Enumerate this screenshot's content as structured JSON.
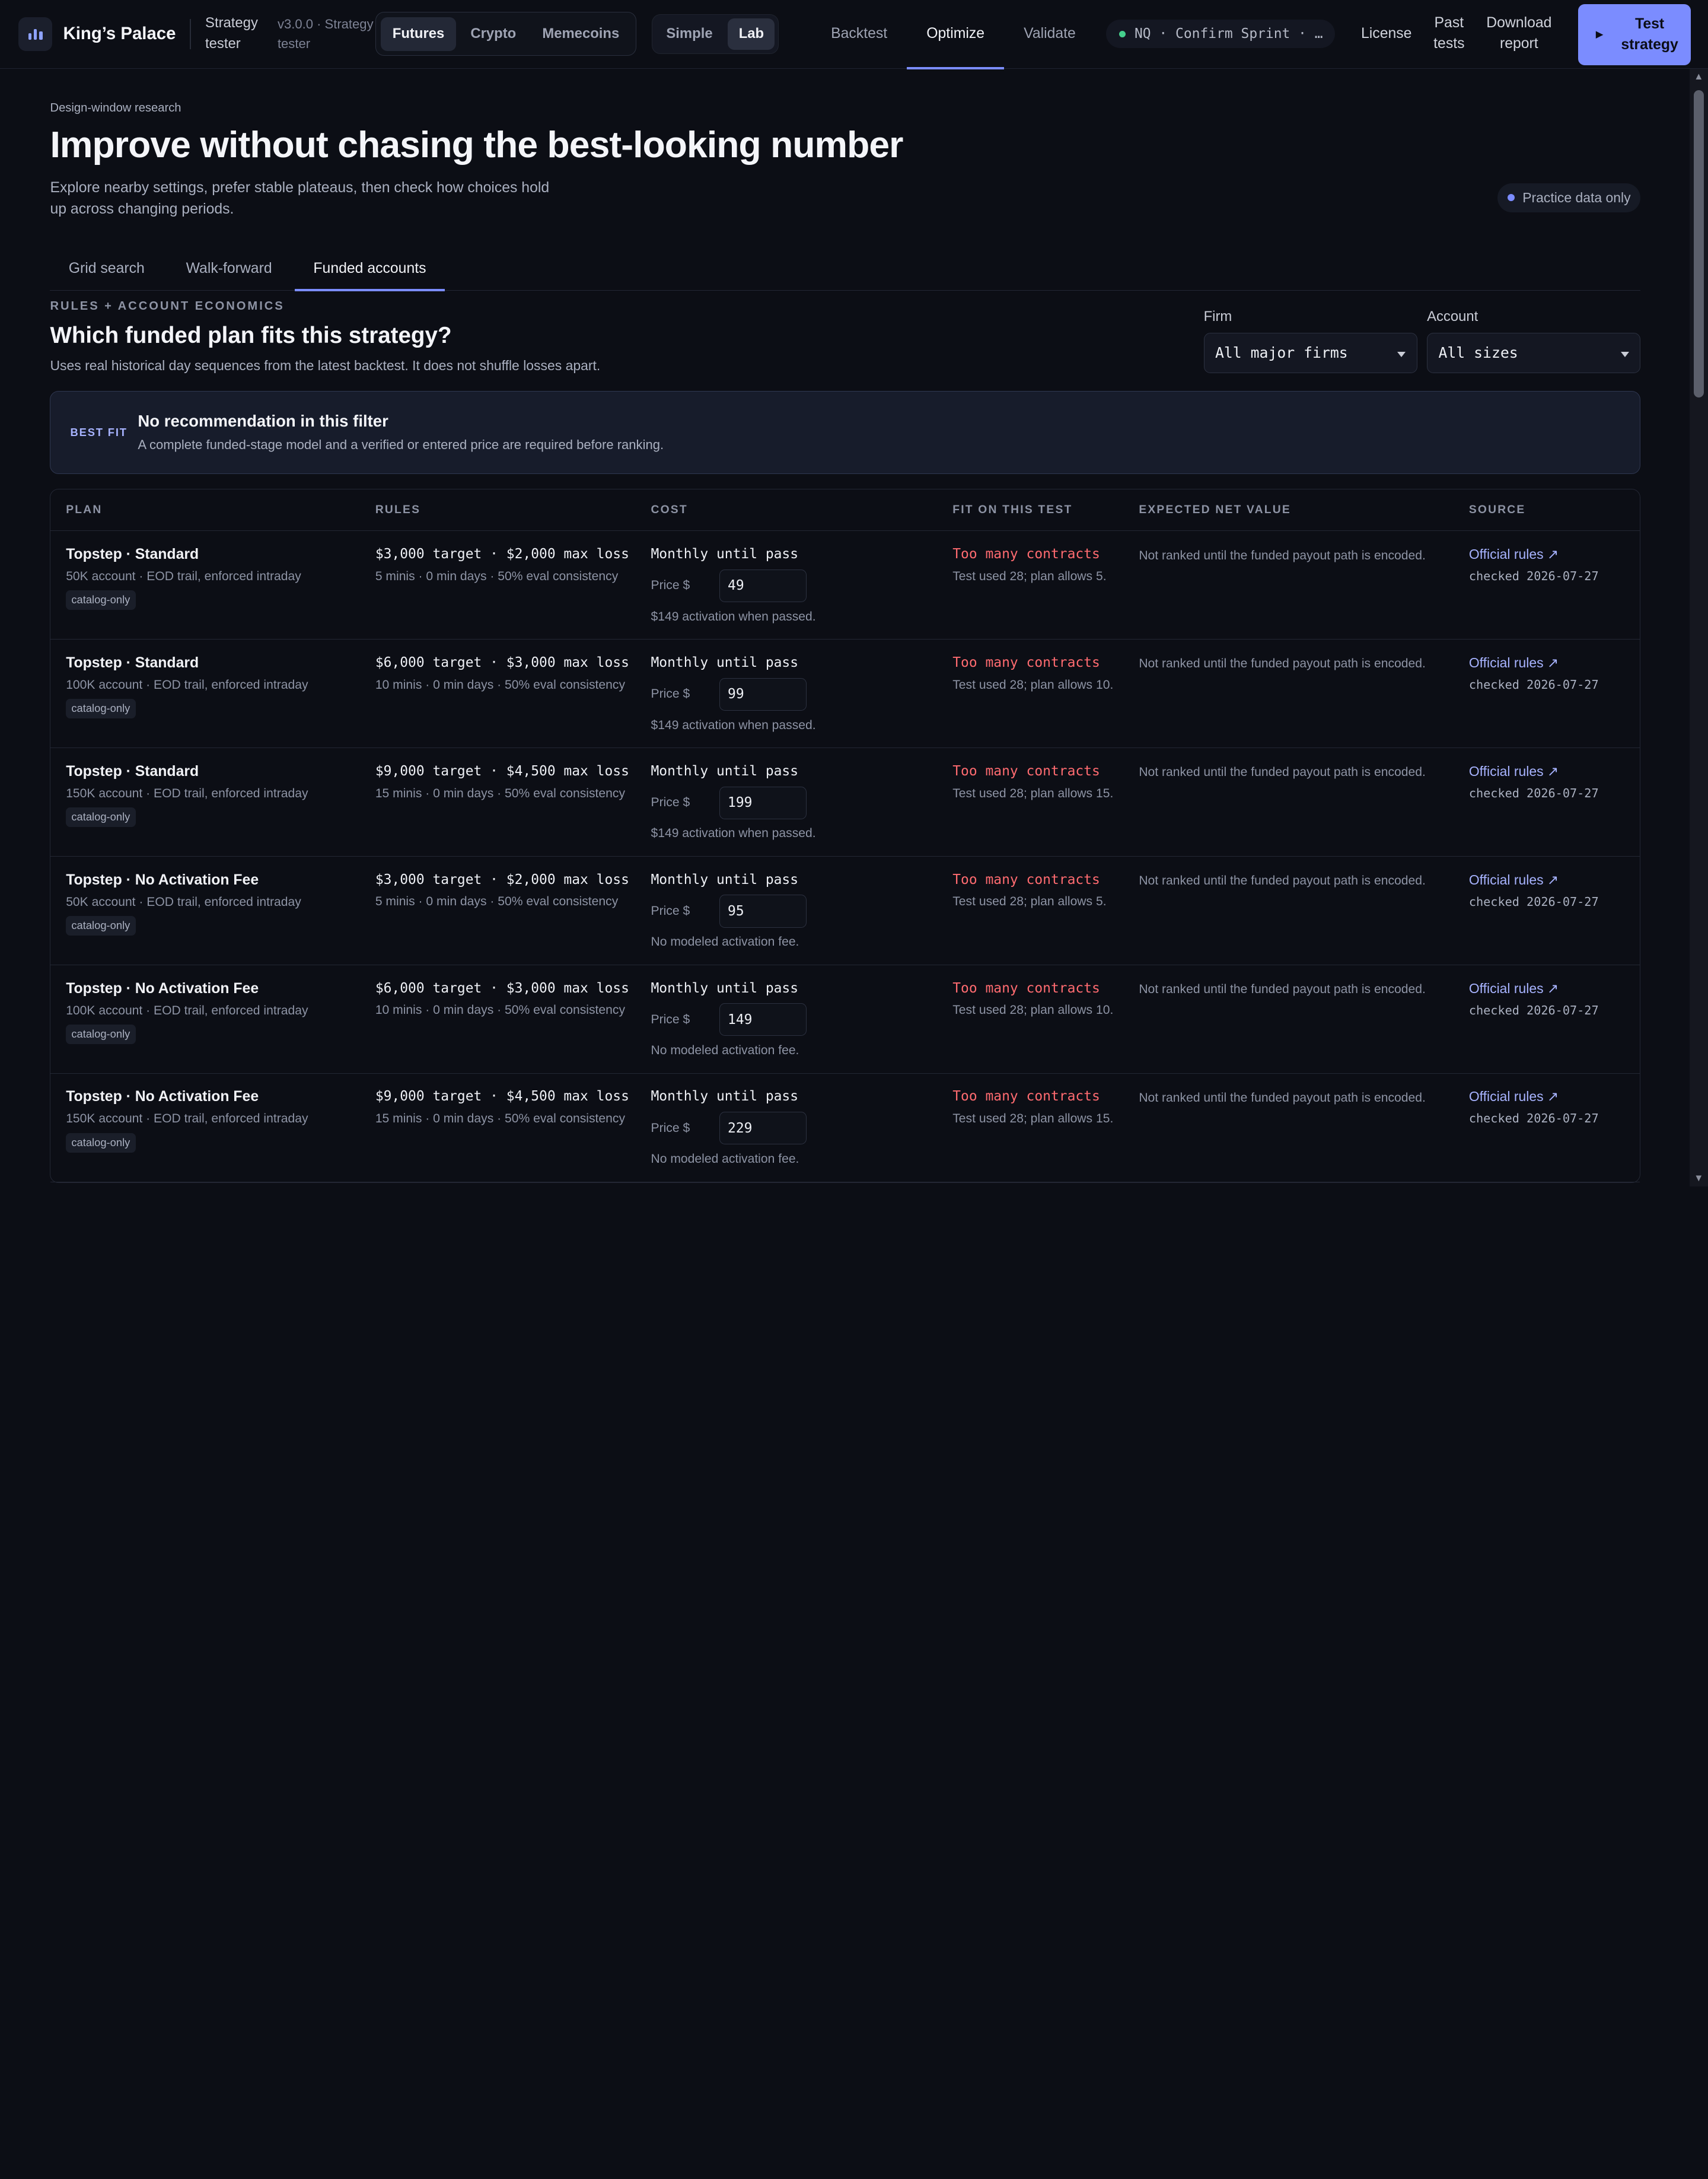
{
  "app": {
    "brand": "King’s Palace",
    "subtitle_line1": "Strategy",
    "subtitle_line2": "tester",
    "version_line1": "v3.0.0 · Strategy",
    "version_line2": "tester"
  },
  "market_tabs": [
    "Futures",
    "Crypto",
    "Memecoins"
  ],
  "mode_tabs": [
    "Simple",
    "Lab"
  ],
  "nav": [
    "Backtest",
    "Optimize",
    "Validate"
  ],
  "strategy_pill": "NQ · Confirm Sprint · …",
  "right_links": {
    "license": "License",
    "past_line1": "Past",
    "past_line2": "tests",
    "download_line1": "Download",
    "download_line2": "report"
  },
  "test_button": {
    "line1": "Test",
    "line2": "strategy",
    "icon": "play-icon"
  },
  "hero": {
    "eyebrow": "Design-window research",
    "title": "Improve without chasing the best-looking number",
    "lede": "Explore nearby settings, prefer stable plateaus, then check how choices hold up across changing periods.",
    "badge": "Practice data only"
  },
  "tabs": [
    "Grid search",
    "Walk-forward",
    "Funded accounts"
  ],
  "section": {
    "kicker": "RULES + ACCOUNT ECONOMICS",
    "title": "Which funded plan fits this strategy?",
    "subtitle": "Uses real historical day sequences from the latest backtest. It does not shuffle losses apart."
  },
  "filters": {
    "firm_label": "Firm",
    "firm_value": "All major firms",
    "account_label": "Account",
    "account_value": "All sizes"
  },
  "best_fit": {
    "tag": "BEST FIT",
    "title": "No recommendation in this filter",
    "desc": "A complete funded-stage model and a verified or entered price are required before ranking."
  },
  "table": {
    "headers": [
      "PLAN",
      "RULES",
      "COST",
      "FIT ON THIS TEST",
      "EXPECTED NET VALUE",
      "SOURCE"
    ],
    "rows": [
      {
        "plan": "Topstep · Standard",
        "plan_desc": "50K account · EOD trail, enforced intraday",
        "chip": "catalog-only",
        "rules": "$3,000 target · $2,000 max loss",
        "rules_desc": "5 minis · 0 min days · 50% eval consistency",
        "cost": "Monthly until pass",
        "price_label": "Price $",
        "price": "49",
        "cost_note": "$149 activation when passed.",
        "fit": "Too many contracts",
        "fit_desc": "Test used 28; plan allows 5.",
        "ev": "Not ranked until the funded payout path is encoded.",
        "source": "Official rules ↗",
        "checked": "checked 2026-07-27"
      },
      {
        "plan": "Topstep · Standard",
        "plan_desc": "100K account · EOD trail, enforced intraday",
        "chip": "catalog-only",
        "rules": "$6,000 target · $3,000 max loss",
        "rules_desc": "10 minis · 0 min days · 50% eval consistency",
        "cost": "Monthly until pass",
        "price_label": "Price $",
        "price": "99",
        "cost_note": "$149 activation when passed.",
        "fit": "Too many contracts",
        "fit_desc": "Test used 28; plan allows 10.",
        "ev": "Not ranked until the funded payout path is encoded.",
        "source": "Official rules ↗",
        "checked": "checked 2026-07-27"
      },
      {
        "plan": "Topstep · Standard",
        "plan_desc": "150K account · EOD trail, enforced intraday",
        "chip": "catalog-only",
        "rules": "$9,000 target · $4,500 max loss",
        "rules_desc": "15 minis · 0 min days · 50% eval consistency",
        "cost": "Monthly until pass",
        "price_label": "Price $",
        "price": "199",
        "cost_note": "$149 activation when passed.",
        "fit": "Too many contracts",
        "fit_desc": "Test used 28; plan allows 15.",
        "ev": "Not ranked until the funded payout path is encoded.",
        "source": "Official rules ↗",
        "checked": "checked 2026-07-27"
      },
      {
        "plan": "Topstep · No Activation Fee",
        "plan_desc": "50K account · EOD trail, enforced intraday",
        "chip": "catalog-only",
        "rules": "$3,000 target · $2,000 max loss",
        "rules_desc": "5 minis · 0 min days · 50% eval consistency",
        "cost": "Monthly until pass",
        "price_label": "Price $",
        "price": "95",
        "cost_note": "No modeled activation fee.",
        "fit": "Too many contracts",
        "fit_desc": "Test used 28; plan allows 5.",
        "ev": "Not ranked until the funded payout path is encoded.",
        "source": "Official rules ↗",
        "checked": "checked 2026-07-27"
      },
      {
        "plan": "Topstep · No Activation Fee",
        "plan_desc": "100K account · EOD trail, enforced intraday",
        "chip": "catalog-only",
        "rules": "$6,000 target · $3,000 max loss",
        "rules_desc": "10 minis · 0 min days · 50% eval consistency",
        "cost": "Monthly until pass",
        "price_label": "Price $",
        "price": "149",
        "cost_note": "No modeled activation fee.",
        "fit": "Too many contracts",
        "fit_desc": "Test used 28; plan allows 10.",
        "ev": "Not ranked until the funded payout path is encoded.",
        "source": "Official rules ↗",
        "checked": "checked 2026-07-27"
      },
      {
        "plan": "Topstep · No Activation Fee",
        "plan_desc": "150K account · EOD trail, enforced intraday",
        "chip": "catalog-only",
        "rules": "$9,000 target · $4,500 max loss",
        "rules_desc": "15 minis · 0 min days · 50% eval consistency",
        "cost": "Monthly until pass",
        "price_label": "Price $",
        "price": "229",
        "cost_note": "No modeled activation fee.",
        "fit": "Too many contracts",
        "fit_desc": "Test used 28; plan allows 15.",
        "ev": "Not ranked until the funded payout path is encoded.",
        "source": "Official rules ↗",
        "checked": "checked 2026-07-27"
      }
    ]
  },
  "colors": {
    "accent": "#7b8cff",
    "danger": "#ff6b70",
    "background": "#0c0e15"
  }
}
